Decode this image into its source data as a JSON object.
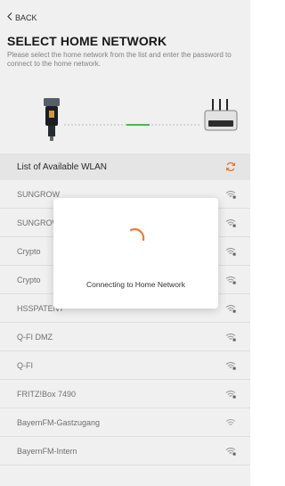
{
  "nav": {
    "back_label": "BACK"
  },
  "header": {
    "title": "SELECT HOME NETWORK",
    "subtitle": "Please select the home network from the list and enter the password to connect to the home network."
  },
  "list": {
    "header": "List of Available WLAN",
    "items": [
      {
        "ssid": "SUNGROW"
      },
      {
        "ssid": "SUNGROW"
      },
      {
        "ssid": "Crypto"
      },
      {
        "ssid": "Crypto"
      },
      {
        "ssid": "HSSPATENT"
      },
      {
        "ssid": "Q-FI DMZ"
      },
      {
        "ssid": "Q-FI"
      },
      {
        "ssid": "FRITZ!Box 7490"
      },
      {
        "ssid": "BayernFM-Gastzugang"
      },
      {
        "ssid": "BayernFM-Intern"
      }
    ]
  },
  "modal": {
    "message": "Connecting to Home Network"
  },
  "icons": {
    "back": "chevron-left-icon",
    "refresh": "refresh-icon",
    "wifi": "wifi-locked-icon",
    "spinner": "loading-spinner-icon",
    "dongle": "wifi-dongle-icon",
    "router": "router-icon"
  },
  "colors": {
    "accent": "#f07b2b",
    "connection_line": "#4cc84c",
    "header_bg": "#f4f4f4"
  }
}
